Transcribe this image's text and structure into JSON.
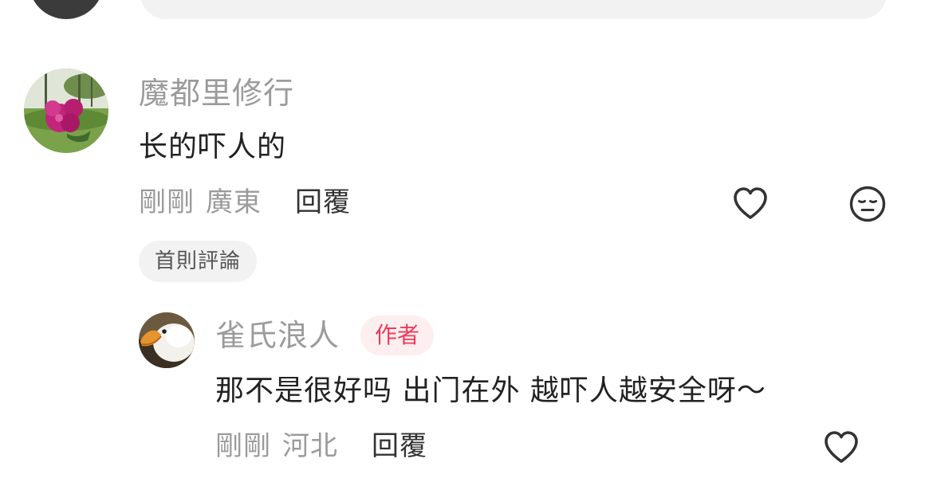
{
  "comment": {
    "username": "魔都里修行",
    "text": "长的吓人的",
    "time": "剛剛",
    "location": "廣東",
    "reply_label": "回覆",
    "pinned_label": "首則評論"
  },
  "reply": {
    "username": "雀氏浪人",
    "author_badge": "作者",
    "text": "那不是很好吗 出门在外 越吓人越安全呀～",
    "time": "剛剛",
    "location": "河北",
    "reply_label": "回覆"
  },
  "colors": {
    "secondary_text": "#9b9b9b",
    "primary_text": "#222222",
    "author_badge_bg": "#fdeef0",
    "author_badge_text": "#ef3b5a",
    "pill_bg": "#f2f2f2"
  },
  "icons": {
    "like": "heart-outline-icon",
    "dislike": "neutral-face-icon"
  }
}
